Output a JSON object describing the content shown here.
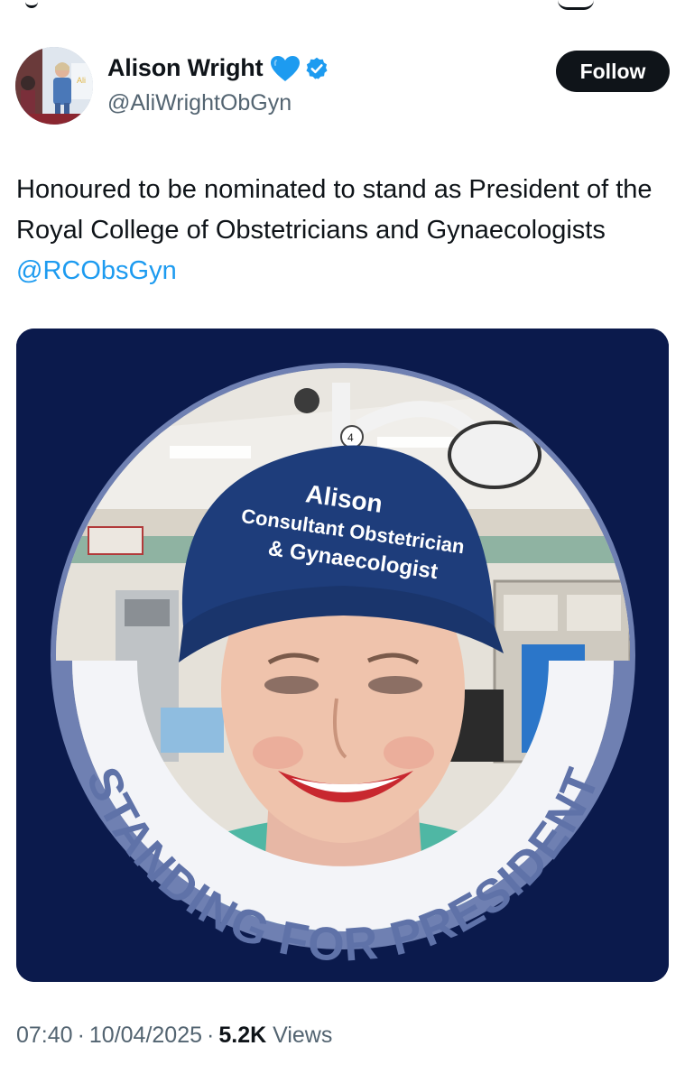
{
  "author": {
    "name": "Alison Wright",
    "handle": "@AliWrightObGyn",
    "follow_label": "Follow",
    "heart_color": "#1d9bf0",
    "verified_color": "#1d9bf0",
    "avatar_backdrop_text": "Ali"
  },
  "tweet": {
    "text_before_mention": "Honoured to be nominated to stand as President of the Royal College of Obstetricians and Gynaecologists ",
    "mention": "@RCObsGyn"
  },
  "media": {
    "cap_line_1": "Alison",
    "cap_line_2": "Consultant Obstetrician",
    "cap_line_3": "& Gynaecologist",
    "ring_text": "STANDING FOR PRESIDENT",
    "lamp_number": "4",
    "background_color": "#0b1a4c",
    "ring_text_color": "#5f72a8"
  },
  "meta": {
    "time": "07:40",
    "date": "10/04/2025",
    "views_count": "5.2K",
    "views_label": "Views",
    "separator": "·"
  }
}
